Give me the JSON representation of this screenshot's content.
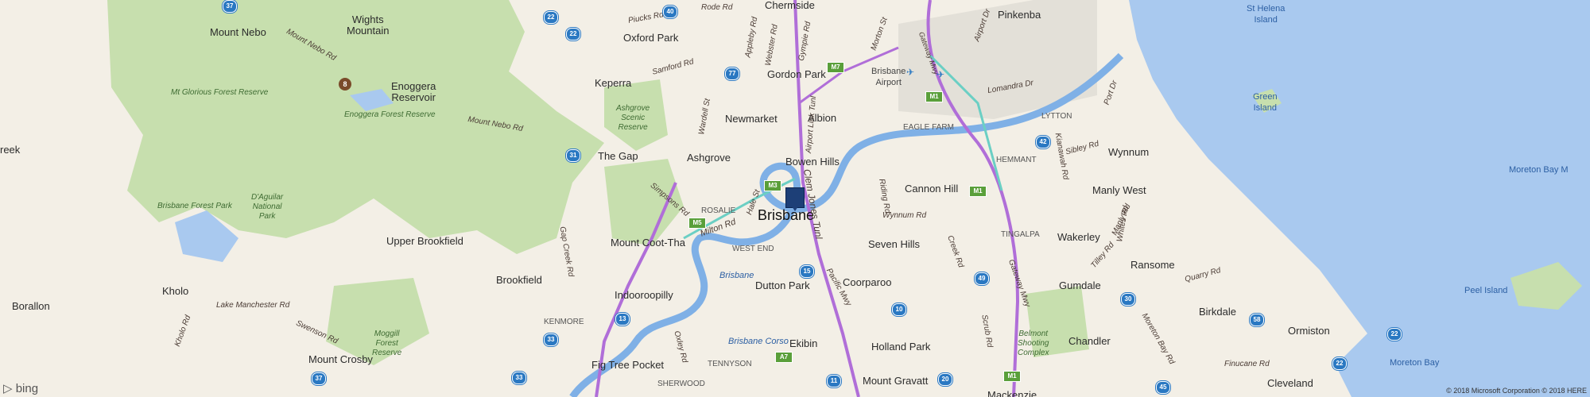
{
  "map": {
    "places": {
      "chermside": "Chermside",
      "pinkenba": "Pinkenba",
      "st_helena": "St Helena\nIsland",
      "mount_nebo": "Mount Nebo",
      "wights_mountain": "Wights\nMountain",
      "oxford_park": "Oxford Park",
      "gordon_park": "Gordon Park",
      "keperra": "Keperra",
      "enoggera_reservoir": "Enoggera\nReservoir",
      "newmarket": "Newmarket",
      "albion": "Albion",
      "brisbane_airport": "Brisbane\nAirport",
      "green_island": "Green\nIsland",
      "the_gap": "The Gap",
      "ashgrove": "Ashgrove",
      "bowen_hills": "Bowen Hills",
      "wynnum": "Wynnum",
      "moreton_bay_label": "Moreton Bay M",
      "cannon_hill": "Cannon Hill",
      "manly_west": "Manly West",
      "brisbane": "Brisbane",
      "upper_brookfield": "Upper Brookfield",
      "mount_coot_tha": "Mount Coot-Tha",
      "seven_hills": "Seven Hills",
      "wakerley": "Wakerley",
      "ransome": "Ransome",
      "brookfield": "Brookfield",
      "gumdale": "Gumdale",
      "kholo": "Kholo",
      "indooroopilly": "Indooroopilly",
      "dutton_park": "Dutton Park",
      "coorparoo": "Coorparoo",
      "borallon": "Borallon",
      "peel_island": "Peel Island",
      "birkdale": "Birkdale",
      "ormiston": "Ormiston",
      "chandler": "Chandler",
      "mount_crosby": "Mount Crosby",
      "fig_tree_pocket": "Fig Tree Pocket",
      "ekibin": "Ekibin",
      "holland_park": "Holland Park",
      "moreton_bay": "Moreton Bay",
      "mount_gravatt": "Mount Gravatt",
      "cleveland": "Cleveland",
      "mackenzie": "Mackenzie",
      "creek": "reek"
    },
    "areas": {
      "mt_glorious": "Mt Glorious Forest Reserve",
      "enoggera_forest": "Enoggera Forest Reserve",
      "ashgrove_scenic": "Ashgrove\nScenic\nReserve",
      "brisbane_forest_park": "Brisbane Forest Park",
      "daguilar": "D'Aguilar\nNational\nPark",
      "moggill": "Moggill\nForest\nReserve",
      "belmont": "Belmont\nShooting\nComplex",
      "eagle_farm": "EAGLE FARM",
      "lytton": "LYTTON",
      "hemmant": "HEMMANT",
      "rosalie": "ROSALIE",
      "west_end": "WEST END",
      "tingalpa": "TINGALPA",
      "kenmore": "KENMORE",
      "tennyson": "TENNYSON",
      "sherwood": "SHERWOOD",
      "brisbane_river": "Brisbane",
      "brisbane_corso": "Brisbane Corso"
    },
    "roads": {
      "mount_nebo_rd": "Mount Nebo Rd",
      "mount_nebo_rd2": "Mount Nebo Rd",
      "samford_rd": "Samford Rd",
      "wardell_st": "Wardell St",
      "appleby_rd": "Appleby Rd",
      "webster_rd": "Webster Rd",
      "gympie_rd": "Gympie Rd",
      "airport_link": "Airport Link Tunl",
      "clem_jones": "Clem Jones Tunl",
      "milton_rd": "Milton Rd",
      "wynnum_rd": "Wynnum Rd",
      "gateway_mwy": "Gateway Mwy",
      "gateway_mwy2": "Gateway Mwy",
      "manly_rd": "Manly Rd",
      "quarry_rd": "Quarry Rd",
      "moreton_bay_rd": "Moreton Bay Rd",
      "finucane_rd": "Finucane Rd",
      "lake_manchester_rd": "Lake Manchester Rd",
      "kholo_rd": "Kholo Rd",
      "swensons_rd": "Swenson Rd",
      "gap_creek_rd": "Gap Creek Rd",
      "creek_rd": "Creek Rd",
      "scrub_rd": "Scrub Rd",
      "riding_rd": "Riding Rd",
      "pacific_mwy": "Pacific Mwy",
      "sibley_rd": "Sibley Rd",
      "kianawah_rd": "Kianawah Rd",
      "tilley_rd": "Tilley Rd",
      "port_dr": "Port Dr",
      "lomandra_dr": "Lomandra Dr",
      "oxley_rd": "Oxley Rd",
      "hale_st": "Hale St",
      "simpsons_rd": "Simpsons Rd",
      "rode_rd": "Rode Rd",
      "piucks_rd": "Piucks Rd",
      "airport_dr": "Airport Dr",
      "mortgg": "Morton St",
      "whites_rd": "Whites Rd"
    },
    "shields": {
      "s37a": "37",
      "s22a": "22",
      "s40": "40",
      "s22b": "22",
      "s77": "77",
      "s8": "8",
      "s31": "31",
      "s42": "42",
      "s49": "49",
      "s15": "15",
      "s10": "10",
      "s33a": "33",
      "s33b": "33",
      "s13": "13",
      "s30": "30",
      "s58": "58",
      "s22c": "22",
      "s22d": "22",
      "s37b": "37",
      "s33c": "33",
      "s11": "11",
      "s20": "20",
      "s45": "45",
      "m7": "M7",
      "m1a": "M1",
      "m3": "M3",
      "m1b": "M1",
      "m5": "M5",
      "m1c": "M1",
      "a7": "A7"
    },
    "copyright": "© 2018 Microsoft Corporation © 2018 HERE",
    "brand": "bing",
    "colors": {
      "land": "#f3efe6",
      "park": "#c7dfae",
      "water": "#a9c9ef",
      "motorway": "#b06ed8",
      "marker": "#1d3f77"
    }
  }
}
